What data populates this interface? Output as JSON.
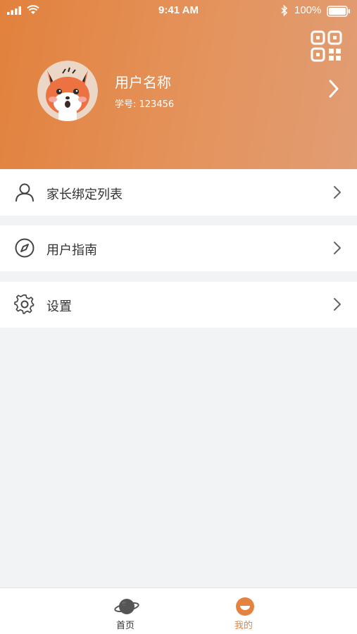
{
  "status_bar": {
    "time": "9:41 AM",
    "battery": "100%"
  },
  "profile": {
    "name": "用户名称",
    "student_id": "学号: 123456",
    "avatar": "fox-cartoon-avatar"
  },
  "menu": [
    {
      "label": "家长绑定列表",
      "icon": "user-icon"
    },
    {
      "label": "用户指南",
      "icon": "compass-icon"
    },
    {
      "label": "设置",
      "icon": "gear-icon"
    }
  ],
  "tabbar": {
    "tabs": [
      {
        "label": "首页",
        "icon": "planet-icon",
        "active": false
      },
      {
        "label": "我的",
        "icon": "smile-icon",
        "active": true
      }
    ]
  },
  "colors": {
    "accent": "#e5823f",
    "tab_inactive": "#333333",
    "tab_active": "#e5823f",
    "background": "#f2f3f5"
  }
}
